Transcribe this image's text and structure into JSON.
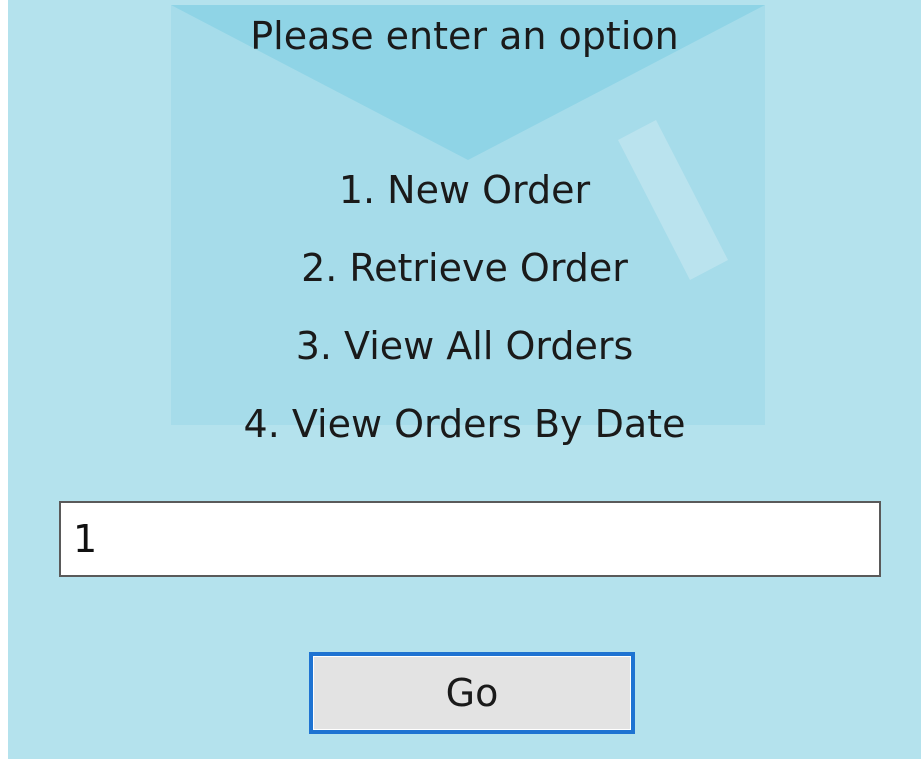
{
  "dialog": {
    "prompt": "Please enter an option",
    "options": [
      "1. New Order",
      "2. Retrieve Order",
      "3. View All Orders",
      "4. View Orders By Date"
    ],
    "input_value": "1",
    "go_label": "Go"
  },
  "colors": {
    "background": "#b4e2ed",
    "button_focus_border": "#1e73d2",
    "button_face": "#e3e3e3"
  }
}
